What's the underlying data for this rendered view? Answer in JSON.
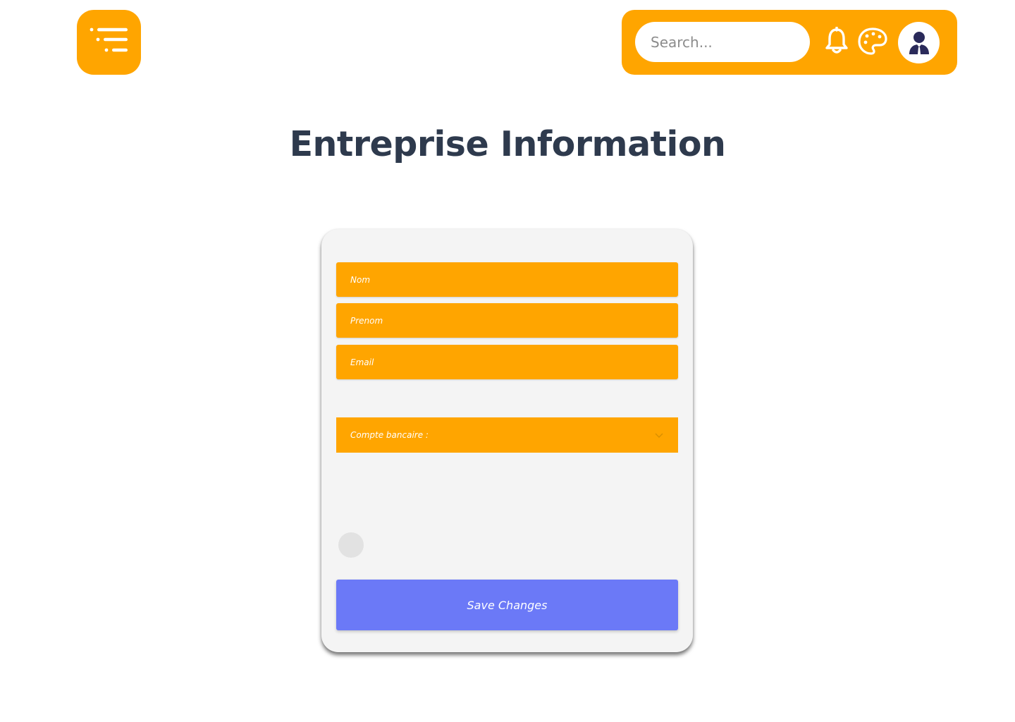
{
  "colors": {
    "accent": "#FFA500",
    "title": "#2E3A4D",
    "button": "#6B79F7",
    "avatar_icon": "#2A2A5A"
  },
  "header": {
    "menu_icon": "menu-lines-icon",
    "search": {
      "placeholder": "Search...",
      "value": ""
    },
    "notification_icon": "bell-icon",
    "theme_icon": "palette-icon",
    "avatar_icon": "user-avatar-icon"
  },
  "main": {
    "title": "Entreprise Information"
  },
  "form": {
    "nom_placeholder": "Nom",
    "prenom_placeholder": "Prenom",
    "email_placeholder": "Email",
    "compte_bancaire_label": "Compte bancaire :",
    "save_label": "Save Changes"
  }
}
